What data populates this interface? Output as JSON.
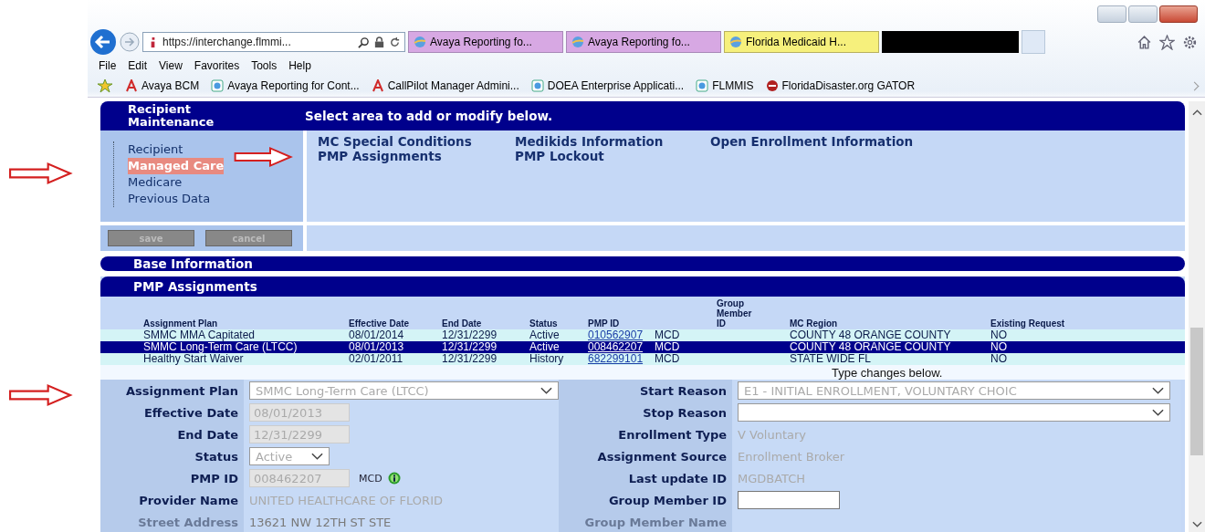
{
  "browser": {
    "address": "https://interchange.flmmi...",
    "tabs": [
      {
        "title": "Avaya Reporting fo...",
        "selected": false
      },
      {
        "title": "Avaya Reporting fo...",
        "selected": false
      },
      {
        "title": "Florida Medicaid H...",
        "selected": true
      }
    ],
    "menu": [
      "File",
      "Edit",
      "View",
      "Favorites",
      "Tools",
      "Help"
    ],
    "favorites": [
      {
        "label": "Avaya BCM",
        "kind": "avaya"
      },
      {
        "label": "Avaya Reporting for Cont...",
        "kind": "page"
      },
      {
        "label": "CallPilot Manager Admini...",
        "kind": "avaya"
      },
      {
        "label": "DOEA Enterprise Applicati...",
        "kind": "page"
      },
      {
        "label": "FLMMIS",
        "kind": "page"
      },
      {
        "label": "FloridaDisaster.org GATOR",
        "kind": "gator"
      }
    ]
  },
  "maintenance": {
    "title": "Recipient Maintenance",
    "header": "Select area to add or modify below.",
    "nav": [
      {
        "label": "Recipient",
        "selected": false
      },
      {
        "label": "Managed Care",
        "selected": true
      },
      {
        "label": "Medicare",
        "selected": false
      },
      {
        "label": "Previous Data",
        "selected": false
      }
    ],
    "links": [
      "MC Special Conditions",
      "Medikids Information",
      "Open Enrollment Information",
      "PMP Assignments",
      "PMP Lockout"
    ],
    "buttons": [
      "save",
      "cancel"
    ]
  },
  "base_information": {
    "title": "Base Information"
  },
  "pmp_assignments": {
    "title": "PMP Assignments",
    "columns": [
      "Assignment Plan",
      "Effective Date",
      "End Date",
      "Status",
      "PMP ID",
      "",
      "Group Member ID",
      "MC Region",
      "Existing Request"
    ],
    "rows": [
      {
        "selected": false,
        "cells": [
          "SMMC MMA Capitated",
          "08/01/2014",
          "12/31/2299",
          "Active",
          "010562907",
          "MCD",
          "",
          "COUNTY 48 ORANGE COUNTY",
          "NO"
        ]
      },
      {
        "selected": true,
        "cells": [
          "SMMC Long-Term Care (LTCC)",
          "08/01/2013",
          "12/31/2299",
          "Active",
          "008462207",
          "MCD",
          "",
          "COUNTY 48 ORANGE COUNTY",
          "NO"
        ]
      },
      {
        "selected": false,
        "cells": [
          "Healthy Start Waiver",
          "02/01/2011",
          "12/31/2299",
          "History",
          "682299101",
          "MCD",
          "",
          "STATE WIDE FL",
          "NO"
        ]
      }
    ],
    "caption": "Type changes below.",
    "form_left": [
      {
        "label": "Assignment Plan",
        "kind": "combo",
        "value": "SMMC Long-Term Care (LTCC)"
      },
      {
        "label": "Effective Date",
        "kind": "text",
        "value": "08/01/2013"
      },
      {
        "label": "End Date",
        "kind": "text",
        "value": "12/31/2299"
      },
      {
        "label": "Status",
        "kind": "select",
        "value": "Active"
      },
      {
        "label": "PMP ID",
        "kind": "text",
        "value": "008462207",
        "suffix": "MCD"
      },
      {
        "label": "Provider Name",
        "kind": "plain",
        "value": "UNITED HEALTHCARE OF FLORID"
      },
      {
        "label": "Street Address",
        "kind": "plain",
        "value": "13621 NW 12TH ST STE"
      }
    ],
    "form_right": [
      {
        "label": "Start Reason",
        "kind": "combo",
        "value": "E1 - INITIAL ENROLLMENT, VOLUNTARY CHOIC"
      },
      {
        "label": "Stop Reason",
        "kind": "combo"
      },
      {
        "label": "Enrollment Type",
        "kind": "plain",
        "value": "V Voluntary"
      },
      {
        "label": "Assignment Source",
        "kind": "plain",
        "value": "Enrollment Broker"
      },
      {
        "label": "Last update ID",
        "kind": "plain",
        "value": "MGDBATCH"
      },
      {
        "label": "Group Member ID",
        "kind": "input"
      },
      {
        "label": "Group Member Name",
        "kind": "plain"
      }
    ]
  }
}
